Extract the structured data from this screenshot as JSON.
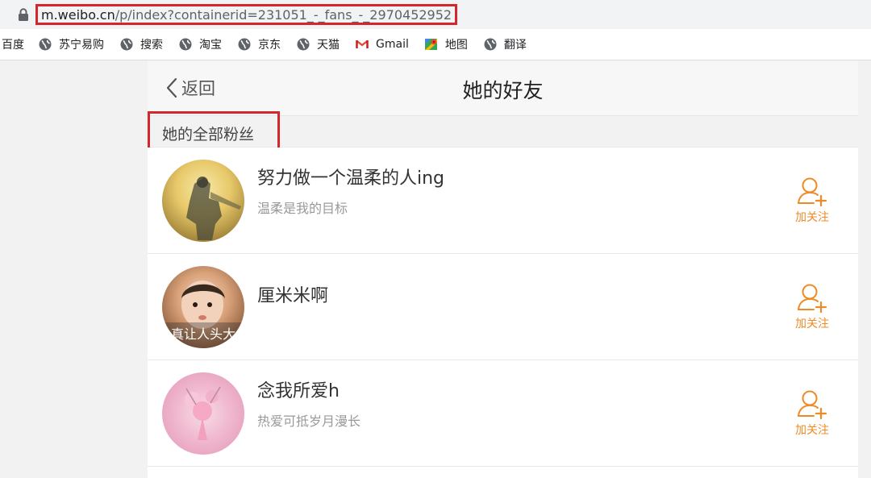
{
  "browser": {
    "url_host": "m.weibo.cn",
    "url_path": "/p/index?containerid=231051_-_fans_-_2970452952",
    "bookmarks": [
      {
        "label": "百度",
        "icon": "none"
      },
      {
        "label": "苏宁易购",
        "icon": "globe-icon"
      },
      {
        "label": "搜索",
        "icon": "globe-icon"
      },
      {
        "label": "淘宝",
        "icon": "globe-icon"
      },
      {
        "label": "京东",
        "icon": "globe-icon"
      },
      {
        "label": "天猫",
        "icon": "globe-icon"
      },
      {
        "label": "Gmail",
        "icon": "gmail-icon"
      },
      {
        "label": "地图",
        "icon": "maps-icon"
      },
      {
        "label": "翻译",
        "icon": "globe-icon"
      }
    ]
  },
  "header": {
    "back_label": "返回",
    "title": "她的好友"
  },
  "section": {
    "title": "她的全部粉丝"
  },
  "fans": [
    {
      "name": "努力做一个温柔的人ing",
      "desc": "温柔是我的目标",
      "follow_label": "加关注"
    },
    {
      "name": "厘米米啊",
      "desc": "",
      "avatar_caption": "真让人头大",
      "follow_label": "加关注"
    },
    {
      "name": "念我所爱h",
      "desc": "热爱可抵岁月漫长",
      "follow_label": "加关注"
    }
  ],
  "colors": {
    "accent": "#f08a24",
    "highlight_box": "#d6262d"
  }
}
